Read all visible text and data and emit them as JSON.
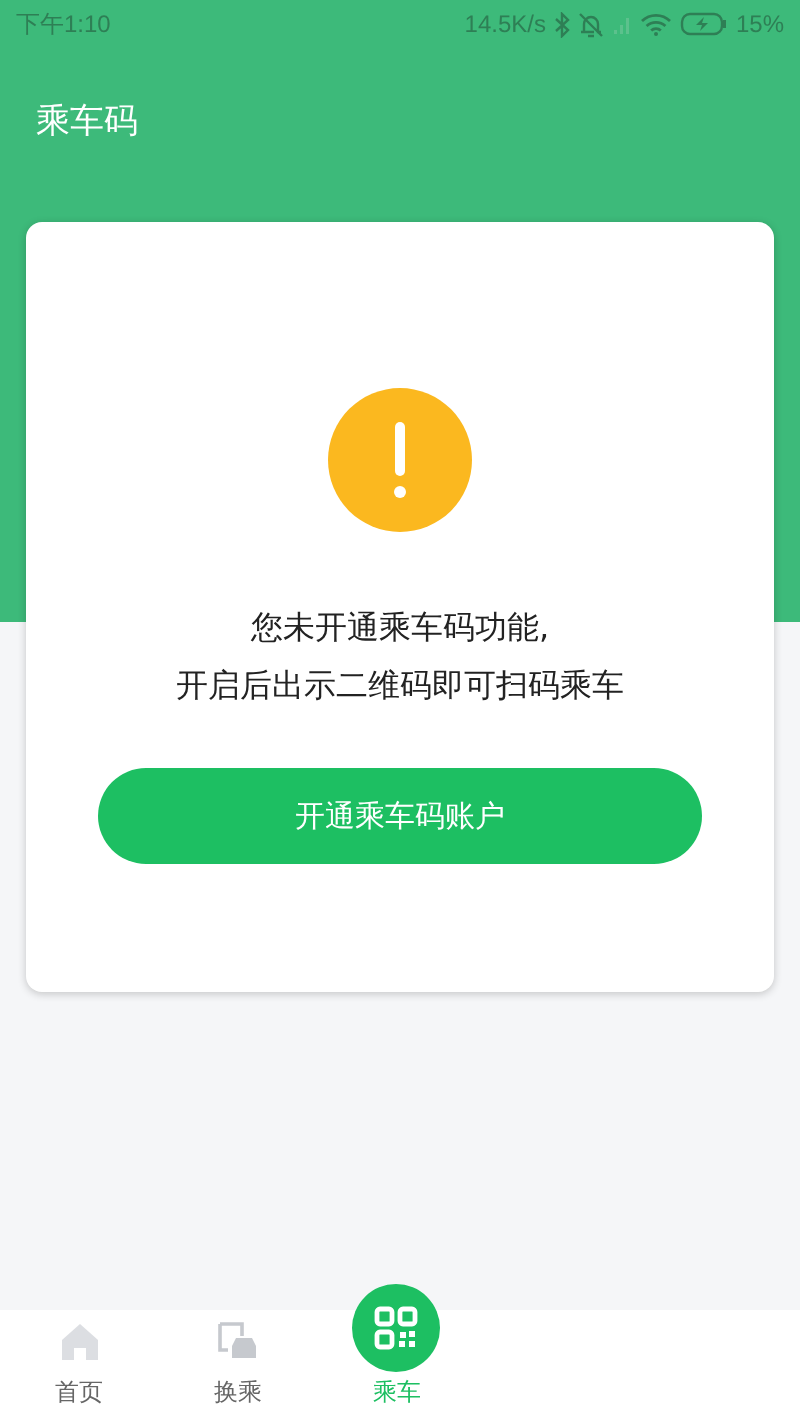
{
  "status_bar": {
    "time": "下午1:10",
    "speed": "14.5K/s",
    "battery": "15%"
  },
  "header": {
    "title": "乘车码"
  },
  "notice": {
    "lines": [
      "您未开通乘车码功能,",
      "开启后出示二维码即可扫码乘车"
    ],
    "button": "开通乘车码账户"
  },
  "tabs": [
    {
      "kind": "home",
      "label": "首页",
      "selected": false
    },
    {
      "kind": "transfer",
      "label": "换乘",
      "selected": false
    },
    {
      "kind": "qr",
      "label": "乘车",
      "selected": true
    }
  ]
}
